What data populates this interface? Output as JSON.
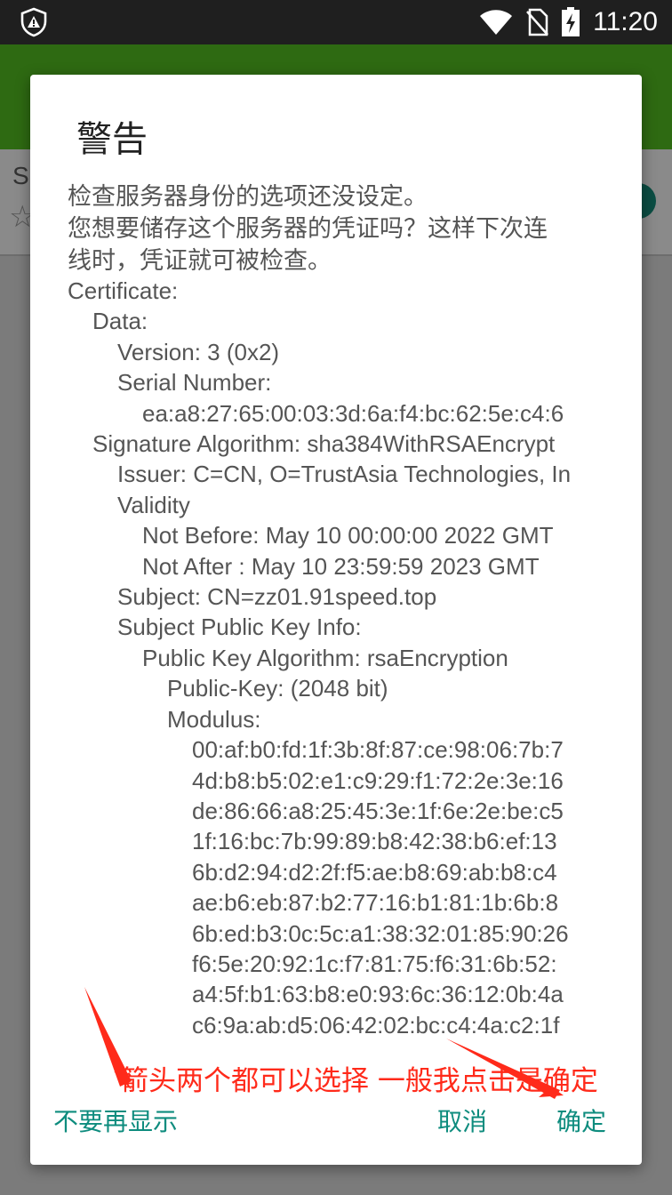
{
  "status_bar": {
    "time": "11:20",
    "icons": [
      "shield-alert-icon",
      "wifi-icon",
      "no-sim-icon",
      "battery-charging-icon"
    ]
  },
  "background": {
    "partial_letter": "S",
    "star_icon": "☆"
  },
  "dialog": {
    "title": "警告",
    "message": [
      "检查服务器身份的选项还没设定。",
      "您想要储存这个服务器的凭证吗？这样下次连",
      "线时，凭证就可被检查。"
    ],
    "certificate_lines": [
      {
        "indent": 0,
        "text": "Certificate:"
      },
      {
        "indent": 1,
        "text": "Data:"
      },
      {
        "indent": 2,
        "text": "Version: 3 (0x2)"
      },
      {
        "indent": 2,
        "text": "Serial Number:"
      },
      {
        "indent": 3,
        "text": "ea:a8:27:65:00:03:3d:6a:f4:bc:62:5e:c4:6"
      },
      {
        "indent": 1,
        "text": "Signature Algorithm: sha384WithRSAEncrypt"
      },
      {
        "indent": 2,
        "text": "Issuer: C=CN, O=TrustAsia Technologies, In"
      },
      {
        "indent": 2,
        "text": "Validity"
      },
      {
        "indent": 3,
        "text": "Not Before: May 10 00:00:00 2022 GMT"
      },
      {
        "indent": 3,
        "text": "Not After : May 10 23:59:59 2023 GMT"
      },
      {
        "indent": 2,
        "text": "Subject: CN=zz01.91speed.top"
      },
      {
        "indent": 2,
        "text": "Subject Public Key Info:"
      },
      {
        "indent": 3,
        "text": "Public Key Algorithm: rsaEncryption"
      },
      {
        "indent": 4,
        "text": "Public-Key: (2048 bit)"
      },
      {
        "indent": 4,
        "text": "Modulus:"
      },
      {
        "indent": 5,
        "text": "00:af:b0:fd:1f:3b:8f:87:ce:98:06:7b:7"
      },
      {
        "indent": 5,
        "text": "4d:b8:b5:02:e1:c9:29:f1:72:2e:3e:16"
      },
      {
        "indent": 5,
        "text": "de:86:66:a8:25:45:3e:1f:6e:2e:be:c5"
      },
      {
        "indent": 5,
        "text": "1f:16:bc:7b:99:89:b8:42:38:b6:ef:13"
      },
      {
        "indent": 5,
        "text": "6b:d2:94:d2:2f:f5:ae:b8:69:ab:b8:c4"
      },
      {
        "indent": 5,
        "text": "ae:b6:eb:87:b2:77:16:b1:81:1b:6b:8"
      },
      {
        "indent": 5,
        "text": "6b:ed:b3:0c:5c:a1:38:32:01:85:90:26"
      },
      {
        "indent": 5,
        "text": "f6:5e:20:92:1c:f7:81:75:f6:31:6b:52:"
      },
      {
        "indent": 5,
        "text": "a4:5f:b1:63:b8:e0:93:6c:36:12:0b:4a"
      },
      {
        "indent": 5,
        "text": "c6:9a:ab:d5:06:42:02:bc:c4:4a:c2:1f"
      }
    ],
    "annotation": "箭头两个都可以选择 一般我点击是确定",
    "buttons": {
      "neutral": "不要再显示",
      "cancel": "取消",
      "ok": "确定"
    },
    "colors": {
      "button_text": "#0e8c7e",
      "annotation": "#ff2a1a",
      "app_bar": "#2e6a12"
    }
  }
}
